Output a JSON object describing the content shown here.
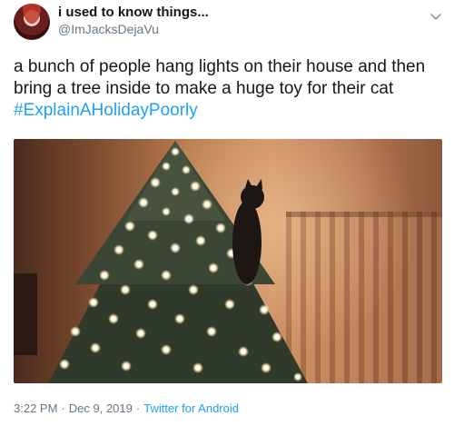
{
  "author": {
    "display_name": "i used to know things...",
    "handle": "@ImJacksDejaVu"
  },
  "tweet": {
    "text_line_1": "a bunch of people hang lights on their house and then",
    "text_line_2": "bring a tree inside to make a huge toy for their cat",
    "hashtag": "#ExplainAHolidayPoorly"
  },
  "meta": {
    "time": "3:22 PM",
    "separator": "·",
    "date": "Dec 9, 2019",
    "source": "Twitter for Android"
  },
  "icons": {
    "caret": "chevron-down-icon"
  },
  "colors": {
    "link": "#1da1f2",
    "secondary_text": "#657786",
    "primary_text": "#14171a"
  }
}
